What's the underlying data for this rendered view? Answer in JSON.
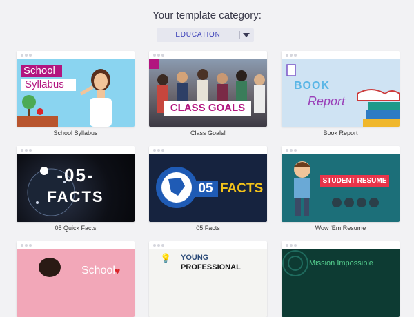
{
  "header": {
    "title": "Your template category:"
  },
  "category_select": {
    "value": "EDUCATION"
  },
  "templates": [
    {
      "caption": "School Syllabus",
      "thumb_text": [
        "School",
        "Syllabus"
      ]
    },
    {
      "caption": "Class Goals!",
      "thumb_text": [
        "CLASS GOALS"
      ]
    },
    {
      "caption": "Book Report",
      "thumb_text": [
        "BOOK",
        "Report"
      ]
    },
    {
      "caption": "05 Quick Facts",
      "thumb_text": [
        "-05-",
        "FACTS"
      ]
    },
    {
      "caption": "05 Facts",
      "thumb_text": [
        "05",
        "FACTS"
      ]
    },
    {
      "caption": "Wow 'Em Resume",
      "thumb_text": [
        "STUDENT RESUME"
      ]
    },
    {
      "caption": "",
      "thumb_text": [
        "School"
      ]
    },
    {
      "caption": "",
      "thumb_text": [
        "YOUNG",
        "PROFESSIONAL"
      ]
    },
    {
      "caption": "",
      "thumb_text": [
        "Mission Impossible"
      ]
    }
  ],
  "colors": {
    "page_bg": "#f2f2f4",
    "accent": "#3a3fb8",
    "syllabus_bg": "#8ad4f0",
    "magenta": "#b2157f",
    "facts_blue": "#1f5bb5",
    "resume_red": "#e8344a"
  }
}
